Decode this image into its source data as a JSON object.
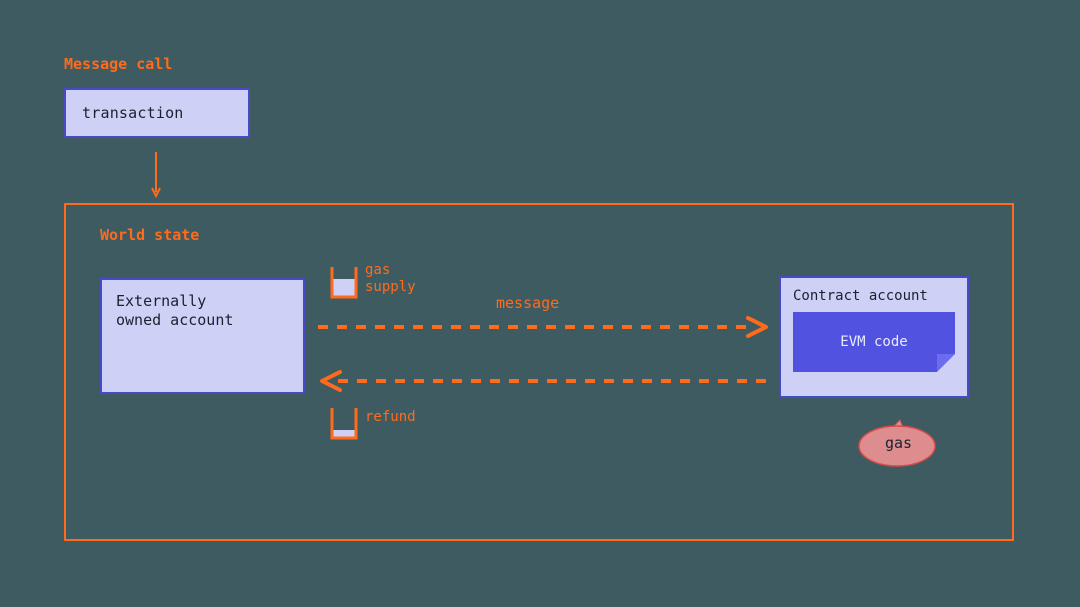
{
  "title": "Message call",
  "transaction_box": "transaction",
  "world": {
    "title": "World state",
    "eoa": {
      "line1": "Externally",
      "line2": "owned account"
    },
    "bucket_supply_label": "gas\nsupply",
    "bucket_refund_label": "refund",
    "message_arrow_label": "message",
    "contract": {
      "title": "Contract account",
      "code_label": "EVM code"
    },
    "gas_bubble": "gas"
  },
  "colors": {
    "bg": "#3f5b62",
    "orange": "#ff6b1a",
    "purple_fill": "#cfd0f6",
    "purple_border": "#4749c8",
    "indigo": "#5152e0",
    "gas_fill": "#dd8d8d",
    "gas_stroke": "#d84a4a"
  }
}
